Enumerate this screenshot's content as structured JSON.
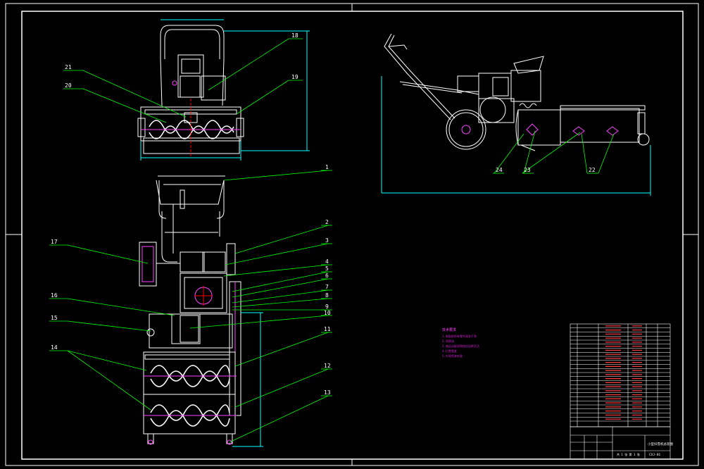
{
  "colors": {
    "background": "#000000",
    "frame": "#ffffff",
    "leader": "#00ff00",
    "part": "#ffffff",
    "hatch": "#ff40ff",
    "dimension": "#00ffff",
    "centerline": "#ff0000",
    "note": "#d020d0"
  },
  "front_view": {
    "callouts": [
      "1",
      "2",
      "3",
      "4",
      "5",
      "6",
      "7",
      "8",
      "9",
      "10",
      "11",
      "12",
      "13",
      "14",
      "15",
      "16",
      "17"
    ]
  },
  "top_view": {
    "callouts": [
      "18",
      "19",
      "20",
      "21"
    ]
  },
  "side_view": {
    "callouts": [
      "22",
      "23",
      "24"
    ]
  },
  "technical_notes": {
    "title": "技术要求",
    "lines": [
      "1.装配前所有零件清洗干净",
      "2.润滑油",
      "3.各运动副润滑良好运转灵活",
      "4.扫雪宽度",
      "5.外观喷漆处理"
    ]
  },
  "title_block": {
    "drawing_title": "小型扫雪机总装图",
    "drawing_number": "CXJ-01",
    "sheet_info": "共 1 张  第 1 张"
  }
}
